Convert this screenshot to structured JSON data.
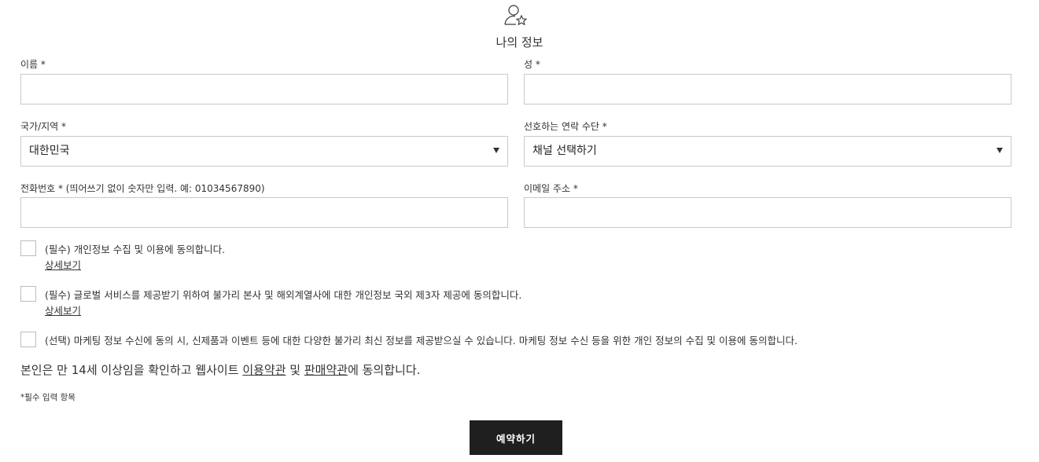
{
  "header": {
    "icon": "user-star-icon",
    "title": "나의 정보"
  },
  "form": {
    "first_name": {
      "label": "이름 *",
      "value": ""
    },
    "last_name": {
      "label": "성 *",
      "value": ""
    },
    "country": {
      "label": "국가/지역 *",
      "selected": "대한민국"
    },
    "contact_channel": {
      "label": "선호하는 연락 수단 *",
      "selected": "채널 선택하기"
    },
    "phone": {
      "label": "전화번호 * (띄어쓰기 없이 숫자만 입력. 예: 01034567890)",
      "value": ""
    },
    "email": {
      "label": "이메일 주소 *",
      "value": ""
    }
  },
  "consents": [
    {
      "text": "(필수) 개인정보 수집 및 이용에 동의합니다.",
      "link": "상세보기",
      "checked": false
    },
    {
      "text": "(필수) 글로벌 서비스를 제공받기 위하여 불가리 본사 및 해외계열사에 대한 개인정보 국외 제3자 제공에 동의합니다.",
      "link": "상세보기",
      "checked": false
    },
    {
      "text": "(선택) 마케팅 정보 수신에 동의 시, 신제품과 이벤트 등에 대한 다양한 불가리 최신 정보를 제공받으실 수 있습니다. 마케팅 정보 수신 등을 위한 개인 정보의 수집 및 이용에 동의합니다.",
      "checked": false
    }
  ],
  "age_consent": {
    "prefix": "본인은 만 14세 이상임을 확인하고 웹사이트 ",
    "terms_link": "이용약관",
    "middle": " 및 ",
    "sales_terms_link": "판매약관",
    "suffix": "에 동의합니다."
  },
  "required_note": "*필수 입력 항목",
  "submit_label": "예약하기"
}
